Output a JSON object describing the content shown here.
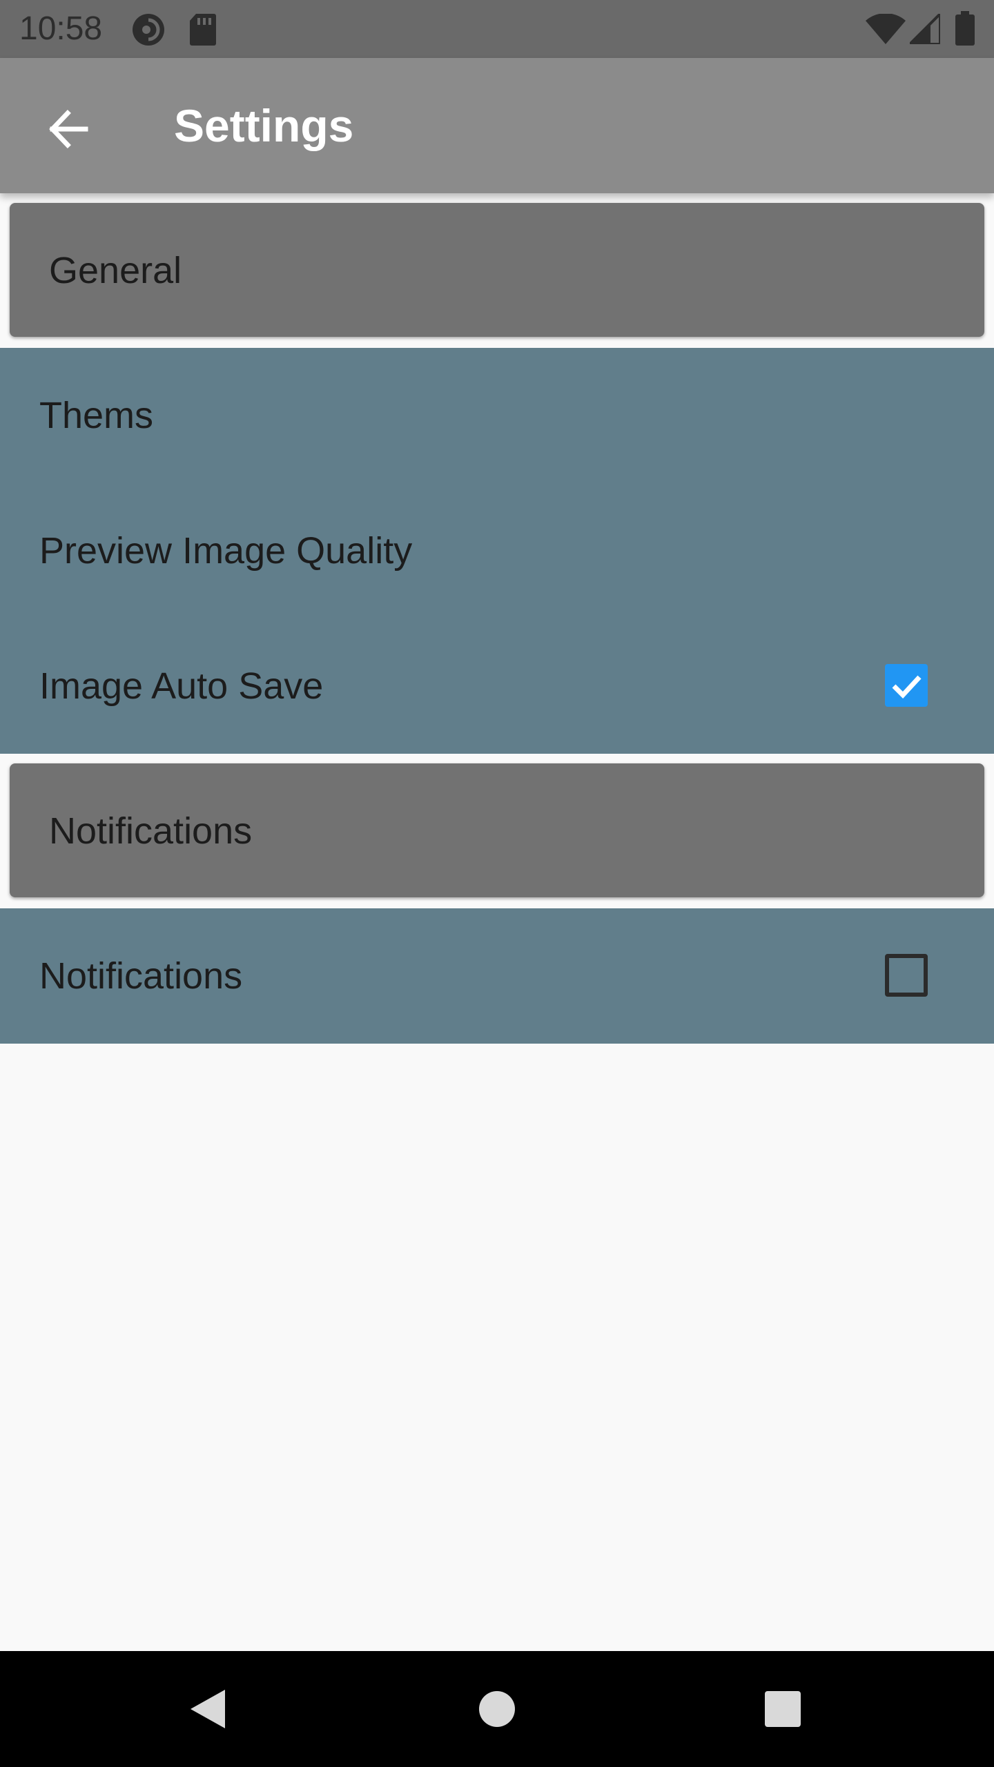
{
  "status_bar": {
    "time": "10:58",
    "left_icons": [
      "pocket-casts-icon",
      "sd-card-icon"
    ],
    "right_icons": [
      "wifi-icon",
      "cell-signal-icon",
      "battery-icon"
    ]
  },
  "app_bar": {
    "title": "Settings",
    "back_icon": "arrow-back-icon"
  },
  "sections": [
    {
      "header": "General",
      "items": [
        {
          "label": "Thems",
          "control": "none"
        },
        {
          "label": "Preview Image Quality",
          "control": "none"
        },
        {
          "label": "Image Auto Save",
          "control": "checkbox",
          "checked": true
        }
      ]
    },
    {
      "header": "Notifications",
      "items": [
        {
          "label": "Notifications",
          "control": "checkbox",
          "checked": false
        }
      ]
    }
  ],
  "nav_bar": {
    "buttons": [
      "back-triangle-icon",
      "home-circle-icon",
      "recents-square-icon"
    ]
  },
  "colors": {
    "status_bar": "#6a6a6a",
    "app_bar": "#8b8b8b",
    "section_header": "#727272",
    "pref_group": "#617e8b",
    "checkbox_accent": "#2196f3",
    "background": "#f9f9f9"
  }
}
